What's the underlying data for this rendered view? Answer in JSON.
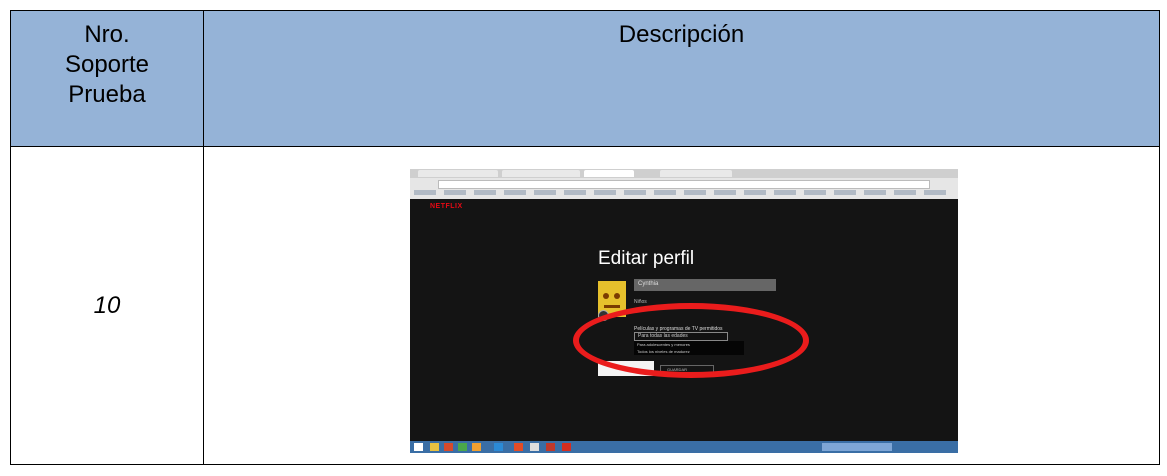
{
  "table": {
    "header_col1": "Nro.\nSoporte\nPrueba",
    "header_col2": "Descripción",
    "row_number": "10"
  },
  "screenshot": {
    "logo": "NETFLIX",
    "title": "Editar perfil",
    "name_value": "Cynthia",
    "kids_label": "Niños",
    "maturity_label": "Películas y programas de TV permitidos",
    "maturity_selected": "Para todas las edades",
    "dropdown_options": [
      "Para adolescentes y menores",
      "Todos los niveles de madurez"
    ],
    "save_label": "GUARDAR"
  },
  "colors": {
    "header_bg": "#95b3d7",
    "highlight": "#ea1c1c",
    "netflix_red": "#e50914"
  }
}
